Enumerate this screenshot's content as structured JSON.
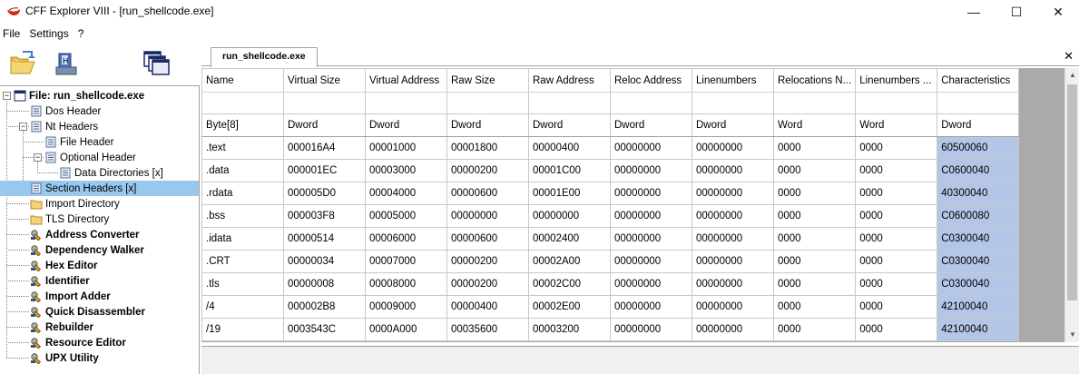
{
  "window": {
    "title": "CFF Explorer VIII - [run_shellcode.exe]",
    "minimize": "—",
    "maximize": "☐",
    "close": "✕"
  },
  "menu": [
    "File",
    "Settings",
    "?"
  ],
  "toolbar": {
    "icons": [
      "open-folder-icon",
      "save-icon",
      "windows-icon"
    ]
  },
  "tree": [
    {
      "label": "File: run_shellcode.exe",
      "bold": true,
      "icon": "file-window-icon"
    },
    {
      "label": "Dos Header",
      "icon": "doc-icon"
    },
    {
      "label": "Nt Headers",
      "icon": "doc-icon"
    },
    {
      "label": "File Header",
      "icon": "doc-icon"
    },
    {
      "label": "Optional Header",
      "icon": "doc-icon"
    },
    {
      "label": "Data Directories [x]",
      "icon": "doc-icon"
    },
    {
      "label": "Section Headers [x]",
      "icon": "doc-icon",
      "selected": true
    },
    {
      "label": "Import Directory",
      "icon": "folder-icon"
    },
    {
      "label": "TLS Directory",
      "icon": "folder-icon"
    },
    {
      "label": "Address Converter",
      "bold": true,
      "icon": "tool-icon"
    },
    {
      "label": "Dependency Walker",
      "bold": true,
      "icon": "tool-icon"
    },
    {
      "label": "Hex Editor",
      "bold": true,
      "icon": "tool-icon"
    },
    {
      "label": "Identifier",
      "bold": true,
      "icon": "tool-icon"
    },
    {
      "label": "Import Adder",
      "bold": true,
      "icon": "tool-icon"
    },
    {
      "label": "Quick Disassembler",
      "bold": true,
      "icon": "tool-icon"
    },
    {
      "label": "Rebuilder",
      "bold": true,
      "icon": "tool-icon"
    },
    {
      "label": "Resource Editor",
      "bold": true,
      "icon": "tool-icon"
    },
    {
      "label": "UPX Utility",
      "bold": true,
      "icon": "tool-icon"
    }
  ],
  "tab": {
    "label": "run_shellcode.exe",
    "close": "✕"
  },
  "grid": {
    "columns": [
      "Name",
      "Virtual Size",
      "Virtual Address",
      "Raw Size",
      "Raw Address",
      "Reloc Address",
      "Linenumbers",
      "Relocations N...",
      "Linenumbers ...",
      "Characteristics"
    ],
    "types": [
      "Byte[8]",
      "Dword",
      "Dword",
      "Dword",
      "Dword",
      "Dword",
      "Dword",
      "Word",
      "Word",
      "Dword"
    ],
    "rows": [
      [
        ".text",
        "000016A4",
        "00001000",
        "00001800",
        "00000400",
        "00000000",
        "00000000",
        "0000",
        "0000",
        "60500060"
      ],
      [
        ".data",
        "000001EC",
        "00003000",
        "00000200",
        "00001C00",
        "00000000",
        "00000000",
        "0000",
        "0000",
        "C0600040"
      ],
      [
        ".rdata",
        "000005D0",
        "00004000",
        "00000600",
        "00001E00",
        "00000000",
        "00000000",
        "0000",
        "0000",
        "40300040"
      ],
      [
        ".bss",
        "000003F8",
        "00005000",
        "00000000",
        "00000000",
        "00000000",
        "00000000",
        "0000",
        "0000",
        "C0600080"
      ],
      [
        ".idata",
        "00000514",
        "00006000",
        "00000600",
        "00002400",
        "00000000",
        "00000000",
        "0000",
        "0000",
        "C0300040"
      ],
      [
        ".CRT",
        "00000034",
        "00007000",
        "00000200",
        "00002A00",
        "00000000",
        "00000000",
        "0000",
        "0000",
        "C0300040"
      ],
      [
        ".tls",
        "00000008",
        "00008000",
        "00000200",
        "00002C00",
        "00000000",
        "00000000",
        "0000",
        "0000",
        "C0300040"
      ],
      [
        "/4",
        "000002B8",
        "00009000",
        "00000400",
        "00002E00",
        "00000000",
        "00000000",
        "0000",
        "0000",
        "42100040"
      ],
      [
        "/19",
        "0003543C",
        "0000A000",
        "00035600",
        "00003200",
        "00000000",
        "00000000",
        "0000",
        "0000",
        "42100040"
      ]
    ]
  },
  "colors": {
    "selection": "#99c8ee",
    "characteristics_highlight": "#b4c6e7"
  }
}
